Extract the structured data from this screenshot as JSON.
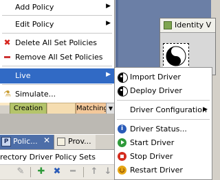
{
  "background": {
    "identity_window_title": "Identity V",
    "timeline_cells": [
      "Creation",
      "Matching"
    ],
    "tabs": [
      {
        "label": "Polic...",
        "active": true,
        "close": "✕"
      },
      {
        "label": "Prov...",
        "active": false
      }
    ],
    "panel_title": "rectory Driver Policy Sets",
    "toolbar_icons": [
      "edit-icon",
      "add-icon",
      "delete-icon",
      "remove-icon",
      "move-up-icon",
      "move-down-icon"
    ]
  },
  "context_menu": {
    "items": [
      {
        "label": "Add Policy",
        "submenu": true
      },
      {
        "label": "Edit Policy",
        "submenu": true
      },
      {
        "label": "Delete All Set Policies",
        "icon": "delete-icon"
      },
      {
        "label": "Remove All Set Policies",
        "icon": "remove-icon"
      },
      {
        "label": "Live",
        "submenu": true,
        "selected": true
      },
      {
        "label": "Simulate...",
        "icon": "simulate-icon"
      }
    ]
  },
  "live_submenu": {
    "items": [
      {
        "label": "Import Driver",
        "icon": "import-driver-icon"
      },
      {
        "label": "Deploy Driver",
        "icon": "deploy-driver-icon"
      },
      {
        "label": "Driver Configuration",
        "submenu": true
      },
      {
        "label": "Driver Status...",
        "icon": "info-icon"
      },
      {
        "label": "Start Driver",
        "icon": "start-icon"
      },
      {
        "label": "Stop Driver",
        "icon": "stop-icon"
      },
      {
        "label": "Restart Driver",
        "icon": "restart-icon"
      }
    ]
  },
  "colors": {
    "menu_highlight": "#316ac5",
    "active_tab": "#4d6ea8",
    "canvas_background": "#5a6f98"
  }
}
